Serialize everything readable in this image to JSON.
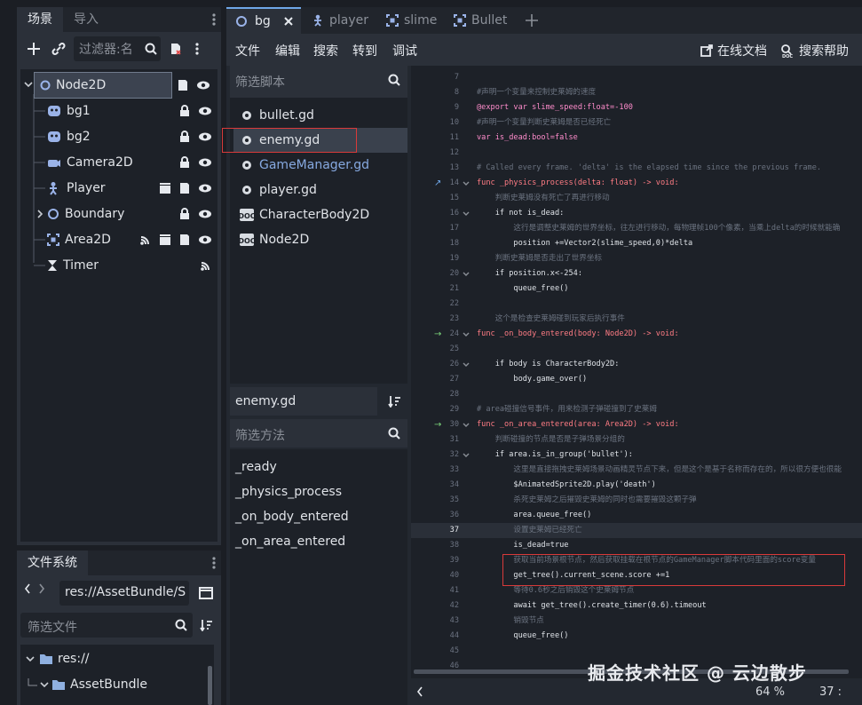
{
  "scene_dock": {
    "tabs": [
      "场景",
      "导入"
    ],
    "filter_placeholder": "过滤器:名",
    "nodes": [
      {
        "name": "Node2D",
        "icon": "node2d-icon",
        "depth": 0
      },
      {
        "name": "bg1",
        "icon": "sprite-icon",
        "depth": 1
      },
      {
        "name": "bg2",
        "icon": "sprite-icon",
        "depth": 1
      },
      {
        "name": "Camera2D",
        "icon": "camera-icon",
        "depth": 1
      },
      {
        "name": "Player",
        "icon": "character-icon",
        "depth": 1
      },
      {
        "name": "Boundary",
        "icon": "node2d-icon",
        "depth": 1
      },
      {
        "name": "Area2D",
        "icon": "area2d-icon",
        "depth": 1
      },
      {
        "name": "Timer",
        "icon": "timer-icon",
        "depth": 1
      }
    ]
  },
  "filesystem": {
    "title": "文件系统",
    "path": "res://AssetBundle/S",
    "filter_placeholder": "筛选文件",
    "items": [
      "res://",
      "AssetBundle"
    ]
  },
  "script_panel": {
    "filter_placeholder": "筛选脚本",
    "scripts": [
      "bullet.gd",
      "enemy.gd",
      "GameManager.gd",
      "player.gd",
      "CharacterBody2D",
      "Node2D"
    ],
    "current": "enemy.gd",
    "method_filter_placeholder": "筛选方法",
    "methods": [
      "_ready",
      "_physics_process",
      "_on_body_entered",
      "_on_area_entered"
    ]
  },
  "editor_tabs": [
    "bg",
    "player",
    "slime",
    "Bullet"
  ],
  "menu": {
    "items": [
      "文件",
      "编辑",
      "搜索",
      "转到",
      "调试"
    ],
    "online_docs": "在线文档",
    "search_help": "搜索帮助"
  },
  "code_lines": [
    {
      "n": "7",
      "t": ""
    },
    {
      "n": "8",
      "t": "#声明一个变量来控制史莱姆的速度"
    },
    {
      "n": "9",
      "t": "@export var slime_speed:float=-100"
    },
    {
      "n": "10",
      "t": "#声明一个变量判断史莱姆是否已经死亡"
    },
    {
      "n": "11",
      "t": "var is_dead:bool=false"
    },
    {
      "n": "12",
      "t": ""
    },
    {
      "n": "13",
      "t": "# Called every frame. 'delta' is the elapsed time since the previous frame."
    },
    {
      "n": "14",
      "t": "func _physics_process(delta: float) -> void:"
    },
    {
      "n": "15",
      "t": "#⟩  判断史莱姆没有死亡了再进行移动"
    },
    {
      "n": "16",
      "t": "⟩|  if not is_dead:"
    },
    {
      "n": "17",
      "t": "#⟩  ⟩|  这行是调整史莱姆的世界坐标，往左进行移动，每物理帧100个像素，当乘上delta的时候就能确"
    },
    {
      "n": "18",
      "t": "⟩|  ⟩|  position +=Vector2(slime_speed,0)*delta"
    },
    {
      "n": "19",
      "t": "#⟩  判断史莱姆是否走出了世界坐标"
    },
    {
      "n": "20",
      "t": "⟩|  if position.x<-254:"
    },
    {
      "n": "21",
      "t": "⟩|  ⟩|  queue_free()"
    },
    {
      "n": "22",
      "t": ""
    },
    {
      "n": "23",
      "t": "#⟩  这个是检查史莱姆碰到玩家后执行事件"
    },
    {
      "n": "24",
      "t": "func _on_body_entered(body: Node2D) -> void:"
    },
    {
      "n": "25",
      "t": ""
    },
    {
      "n": "26",
      "t": "⟩|  if body is CharacterBody2D:"
    },
    {
      "n": "27",
      "t": "⟩|  ⟩|  body.game_over()"
    },
    {
      "n": "28",
      "t": ""
    },
    {
      "n": "29",
      "t": "# area碰撞信号事件，用来检测子弹碰撞到了史莱姆"
    },
    {
      "n": "30",
      "t": "func _on_area_entered(area: Area2D) -> void:"
    },
    {
      "n": "31",
      "t": "#⟩  判断碰撞的节点是否是子弹场景分组的"
    },
    {
      "n": "32",
      "t": "⟩|  if area.is_in_group('bullet'):"
    },
    {
      "n": "33",
      "t": "#⟩  ⟩|  这里是直接拖拽史莱姆场景动画精灵节点下来，但是这个是基于名称而存在的，所以很方便也很能"
    },
    {
      "n": "34",
      "t": "⟩|  ⟩|  $AnimatedSprite2D.play('death')"
    },
    {
      "n": "35",
      "t": "#⟩  ⟩|  杀死史莱姆之后摧毁史莱姆的同时也需要摧毁这颗子弹"
    },
    {
      "n": "36",
      "t": "⟩|  ⟩|  area.queue_free()"
    },
    {
      "n": "37",
      "t": "#⟩  ⟩|  设置史莱姆已经死亡"
    },
    {
      "n": "38",
      "t": "⟩|  ⟩|  is_dead=true"
    },
    {
      "n": "39",
      "t": "#⟩  ⟩|  获取当前场景根节点，然后获取挂载在根节点的GameManager脚本代码里面的score变量"
    },
    {
      "n": "40",
      "t": "⟩|  ⟩|  get_tree().current_scene.score +=1"
    },
    {
      "n": "41",
      "t": "#⟩  ⟩|  等待0.6秒之后销毁这个史莱姆节点"
    },
    {
      "n": "42",
      "t": "⟩|  ⟩|  await  get_tree().create_timer(0.6).timeout"
    },
    {
      "n": "43",
      "t": "#⟩  ⟩|  销毁节点"
    },
    {
      "n": "44",
      "t": "⟩|  ⟩|  queue_free()"
    },
    {
      "n": "45",
      "t": ""
    },
    {
      "n": "46",
      "t": ""
    }
  ],
  "status": {
    "zoom": "64 %",
    "line": "37 :"
  },
  "watermark": "掘金技术社区 @ 云边散步"
}
